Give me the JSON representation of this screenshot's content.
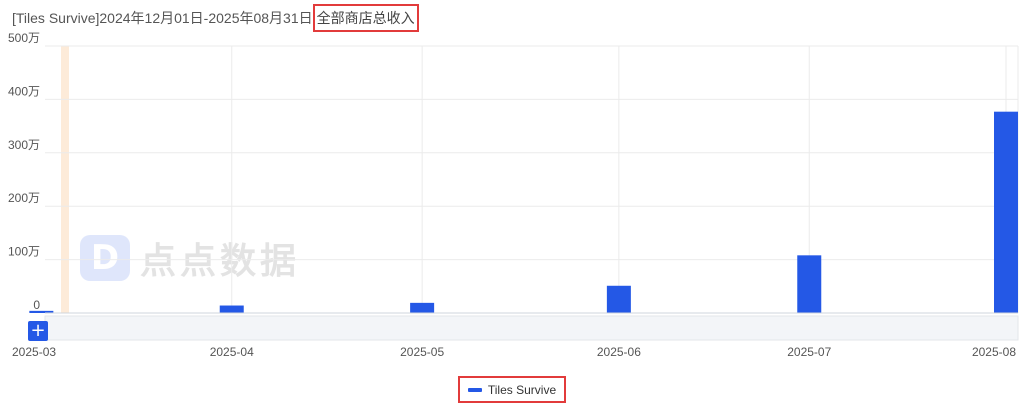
{
  "title": {
    "prefix": "[Tiles Survive]2024年12月01日-2025年08月31日",
    "highlight": "全部商店总收入"
  },
  "watermark": {
    "logo_glyph": "D",
    "text": "点点数据"
  },
  "zoom_button": {
    "label": "+"
  },
  "colors": {
    "bar": "#2458e6",
    "grid": "#ebebeb",
    "highlight_border": "#e23b3b",
    "band": "#fdebd9"
  },
  "chart_data": {
    "type": "bar",
    "title": "全部商店总收入",
    "series": [
      {
        "name": "Tiles Survive",
        "points": [
          {
            "x": "2025-03-02",
            "y": 40000
          },
          {
            "x": "2025-04-01",
            "y": 140000
          },
          {
            "x": "2025-05-01",
            "y": 190000
          },
          {
            "x": "2025-06-01",
            "y": 510000
          },
          {
            "x": "2025-07-01",
            "y": 1080000
          },
          {
            "x": "2025-08-01",
            "y": 3770000
          }
        ]
      }
    ],
    "y_ticks": [
      {
        "value": 0,
        "label": "0"
      },
      {
        "value": 1000000,
        "label": "100万"
      },
      {
        "value": 2000000,
        "label": "200万"
      },
      {
        "value": 3000000,
        "label": "300万"
      },
      {
        "value": 4000000,
        "label": "400万"
      },
      {
        "value": 5000000,
        "label": "500万"
      }
    ],
    "x_ticks": [
      {
        "date": "2025-03-01",
        "label": "2025-03"
      },
      {
        "date": "2025-04-01",
        "label": "2025-04"
      },
      {
        "date": "2025-05-01",
        "label": "2025-05"
      },
      {
        "date": "2025-06-01",
        "label": "2025-06"
      },
      {
        "date": "2025-07-01",
        "label": "2025-07"
      },
      {
        "date": "2025-08-01",
        "label": "2025-08"
      }
    ],
    "ylim": [
      0,
      5000000
    ],
    "grid": true,
    "legend": {
      "position": "bottom-center",
      "label": "Tiles Survive"
    }
  }
}
